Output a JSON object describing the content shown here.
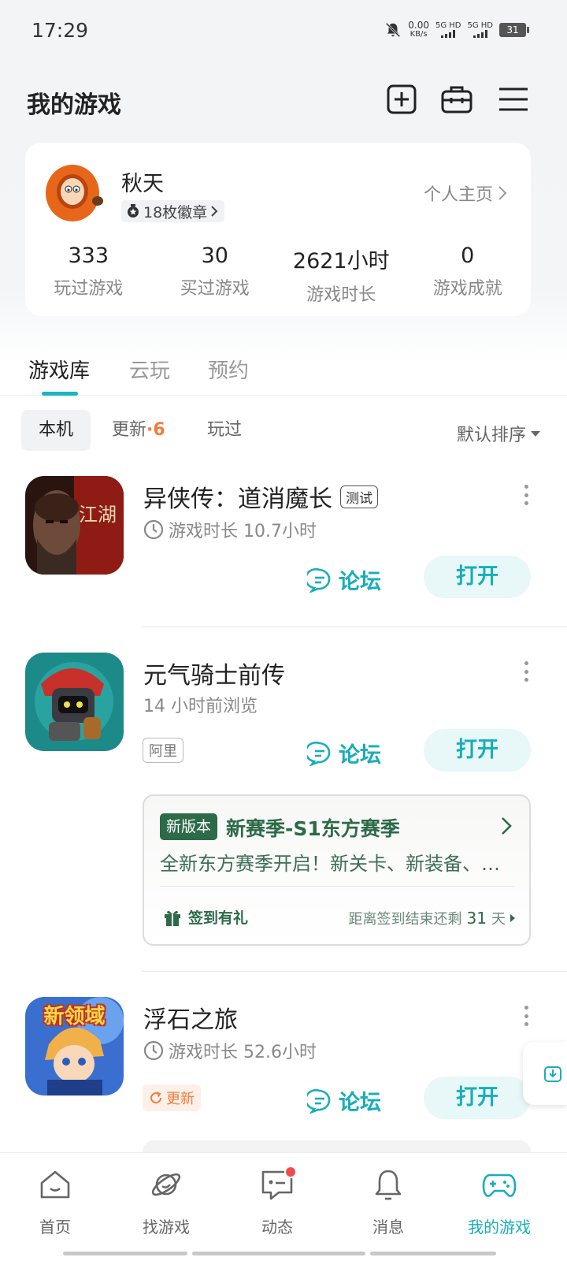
{
  "status_bar": {
    "time": "17:29",
    "net_speed_value": "0.00",
    "net_speed_unit": "KB/s",
    "sim1": "5G HD",
    "sim2": "5G HD",
    "battery": "31"
  },
  "header": {
    "title": "我的游戏",
    "icons": [
      "add-icon",
      "toolbox-icon",
      "menu-icon"
    ]
  },
  "profile": {
    "name": "秋天",
    "badges": "18枚徽章",
    "home_link": "个人主页",
    "stats": [
      {
        "value": "333",
        "label": "玩过游戏"
      },
      {
        "value": "30",
        "label": "买过游戏"
      },
      {
        "value": "2621小时",
        "label": "游戏时长"
      },
      {
        "value": "0",
        "label": "游戏成就"
      }
    ]
  },
  "tabs": [
    {
      "label": "游戏库",
      "active": true
    },
    {
      "label": "云玩",
      "active": false
    },
    {
      "label": "预约",
      "active": false
    }
  ],
  "filters": {
    "local": "本机",
    "update": "更新",
    "update_count": "·6",
    "played": "玩过",
    "sort": "默认排序"
  },
  "games": [
    {
      "name": "异侠传：道消魔长",
      "tag": "测试",
      "sub": "游戏时长 10.7小时",
      "forum": "论坛",
      "open": "打开",
      "icon_text": "江湖"
    },
    {
      "name": "元气骑士前传",
      "sub": "14 小时前浏览",
      "vendor": "阿里",
      "forum": "论坛",
      "open": "打开",
      "news": {
        "badge": "新版本",
        "title": "新赛季-S1东方赛季",
        "body": "全新东方赛季开启！新关卡、新装备、新角色等你来体验",
        "signin": "签到有礼",
        "remain_prefix": "距离签到结束还剩",
        "remain_days": "31",
        "remain_suffix": "天"
      }
    },
    {
      "name": "浮石之旅",
      "sub": "游戏时长 52.6小时",
      "update_tag": "更新",
      "forum": "论坛",
      "open": "打开",
      "icon_text": "新领域"
    }
  ],
  "bottom_nav": [
    {
      "label": "首页",
      "icon": "home-icon"
    },
    {
      "label": "找游戏",
      "icon": "planet-icon"
    },
    {
      "label": "动态",
      "icon": "chat-icon",
      "badge_dot": true
    },
    {
      "label": "消息",
      "icon": "bell-icon"
    },
    {
      "label": "我的游戏",
      "icon": "gamepad-icon",
      "active": true
    }
  ],
  "colors": {
    "accent": "#18aeb8",
    "update_orange": "#f07c3c",
    "news_green": "#2c6a49"
  }
}
